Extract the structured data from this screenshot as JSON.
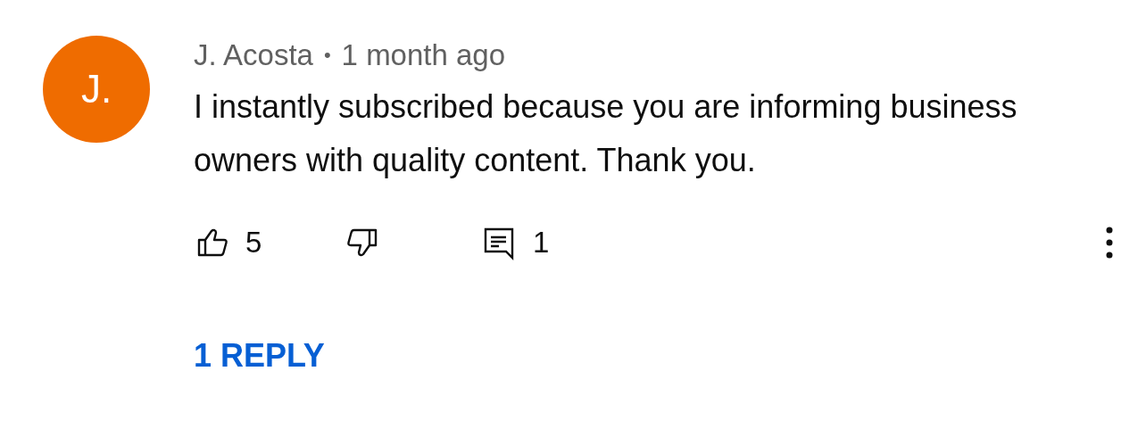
{
  "comment": {
    "avatar_letter": "J.",
    "author": "J. Acosta",
    "separator": "•",
    "time": "1 month ago",
    "text": "I instantly subscribed because you are informing business owners with quality content. Thank you.",
    "likes": "5",
    "replies_count": "1"
  },
  "replies_link": "1 REPLY"
}
